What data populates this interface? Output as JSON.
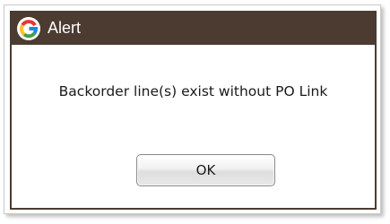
{
  "dialog": {
    "title": "Alert",
    "message": "Backorder line(s) exist without PO Link",
    "ok_label": "OK",
    "icon": "app-logo-icon"
  },
  "colors": {
    "titlebar": "#4b3b30",
    "logo_red": "#e53935",
    "logo_green": "#43a047",
    "logo_blue": "#1e88e5",
    "logo_yellow": "#fbc02d"
  }
}
